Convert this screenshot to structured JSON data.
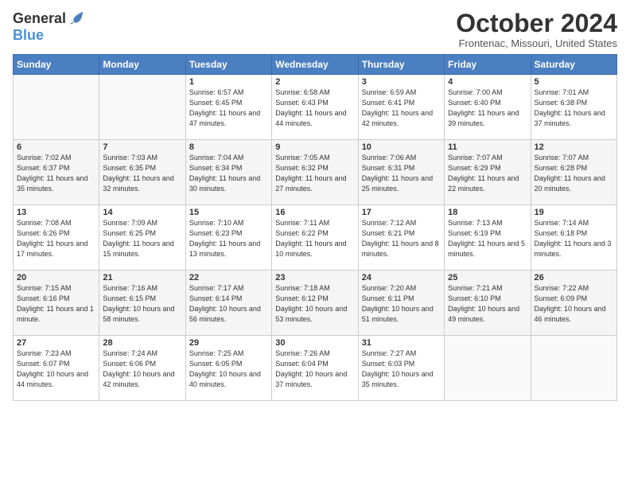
{
  "logo": {
    "general": "General",
    "blue": "Blue"
  },
  "title": "October 2024",
  "location": "Frontenac, Missouri, United States",
  "headers": [
    "Sunday",
    "Monday",
    "Tuesday",
    "Wednesday",
    "Thursday",
    "Friday",
    "Saturday"
  ],
  "weeks": [
    [
      {
        "day": "",
        "info": ""
      },
      {
        "day": "",
        "info": ""
      },
      {
        "day": "1",
        "info": "Sunrise: 6:57 AM\nSunset: 6:45 PM\nDaylight: 11 hours and 47 minutes."
      },
      {
        "day": "2",
        "info": "Sunrise: 6:58 AM\nSunset: 6:43 PM\nDaylight: 11 hours and 44 minutes."
      },
      {
        "day": "3",
        "info": "Sunrise: 6:59 AM\nSunset: 6:41 PM\nDaylight: 11 hours and 42 minutes."
      },
      {
        "day": "4",
        "info": "Sunrise: 7:00 AM\nSunset: 6:40 PM\nDaylight: 11 hours and 39 minutes."
      },
      {
        "day": "5",
        "info": "Sunrise: 7:01 AM\nSunset: 6:38 PM\nDaylight: 11 hours and 37 minutes."
      }
    ],
    [
      {
        "day": "6",
        "info": "Sunrise: 7:02 AM\nSunset: 6:37 PM\nDaylight: 11 hours and 35 minutes."
      },
      {
        "day": "7",
        "info": "Sunrise: 7:03 AM\nSunset: 6:35 PM\nDaylight: 11 hours and 32 minutes."
      },
      {
        "day": "8",
        "info": "Sunrise: 7:04 AM\nSunset: 6:34 PM\nDaylight: 11 hours and 30 minutes."
      },
      {
        "day": "9",
        "info": "Sunrise: 7:05 AM\nSunset: 6:32 PM\nDaylight: 11 hours and 27 minutes."
      },
      {
        "day": "10",
        "info": "Sunrise: 7:06 AM\nSunset: 6:31 PM\nDaylight: 11 hours and 25 minutes."
      },
      {
        "day": "11",
        "info": "Sunrise: 7:07 AM\nSunset: 6:29 PM\nDaylight: 11 hours and 22 minutes."
      },
      {
        "day": "12",
        "info": "Sunrise: 7:07 AM\nSunset: 6:28 PM\nDaylight: 11 hours and 20 minutes."
      }
    ],
    [
      {
        "day": "13",
        "info": "Sunrise: 7:08 AM\nSunset: 6:26 PM\nDaylight: 11 hours and 17 minutes."
      },
      {
        "day": "14",
        "info": "Sunrise: 7:09 AM\nSunset: 6:25 PM\nDaylight: 11 hours and 15 minutes."
      },
      {
        "day": "15",
        "info": "Sunrise: 7:10 AM\nSunset: 6:23 PM\nDaylight: 11 hours and 13 minutes."
      },
      {
        "day": "16",
        "info": "Sunrise: 7:11 AM\nSunset: 6:22 PM\nDaylight: 11 hours and 10 minutes."
      },
      {
        "day": "17",
        "info": "Sunrise: 7:12 AM\nSunset: 6:21 PM\nDaylight: 11 hours and 8 minutes."
      },
      {
        "day": "18",
        "info": "Sunrise: 7:13 AM\nSunset: 6:19 PM\nDaylight: 11 hours and 5 minutes."
      },
      {
        "day": "19",
        "info": "Sunrise: 7:14 AM\nSunset: 6:18 PM\nDaylight: 11 hours and 3 minutes."
      }
    ],
    [
      {
        "day": "20",
        "info": "Sunrise: 7:15 AM\nSunset: 6:16 PM\nDaylight: 11 hours and 1 minute."
      },
      {
        "day": "21",
        "info": "Sunrise: 7:16 AM\nSunset: 6:15 PM\nDaylight: 10 hours and 58 minutes."
      },
      {
        "day": "22",
        "info": "Sunrise: 7:17 AM\nSunset: 6:14 PM\nDaylight: 10 hours and 56 minutes."
      },
      {
        "day": "23",
        "info": "Sunrise: 7:18 AM\nSunset: 6:12 PM\nDaylight: 10 hours and 53 minutes."
      },
      {
        "day": "24",
        "info": "Sunrise: 7:20 AM\nSunset: 6:11 PM\nDaylight: 10 hours and 51 minutes."
      },
      {
        "day": "25",
        "info": "Sunrise: 7:21 AM\nSunset: 6:10 PM\nDaylight: 10 hours and 49 minutes."
      },
      {
        "day": "26",
        "info": "Sunrise: 7:22 AM\nSunset: 6:09 PM\nDaylight: 10 hours and 46 minutes."
      }
    ],
    [
      {
        "day": "27",
        "info": "Sunrise: 7:23 AM\nSunset: 6:07 PM\nDaylight: 10 hours and 44 minutes."
      },
      {
        "day": "28",
        "info": "Sunrise: 7:24 AM\nSunset: 6:06 PM\nDaylight: 10 hours and 42 minutes."
      },
      {
        "day": "29",
        "info": "Sunrise: 7:25 AM\nSunset: 6:05 PM\nDaylight: 10 hours and 40 minutes."
      },
      {
        "day": "30",
        "info": "Sunrise: 7:26 AM\nSunset: 6:04 PM\nDaylight: 10 hours and 37 minutes."
      },
      {
        "day": "31",
        "info": "Sunrise: 7:27 AM\nSunset: 6:03 PM\nDaylight: 10 hours and 35 minutes."
      },
      {
        "day": "",
        "info": ""
      },
      {
        "day": "",
        "info": ""
      }
    ]
  ]
}
